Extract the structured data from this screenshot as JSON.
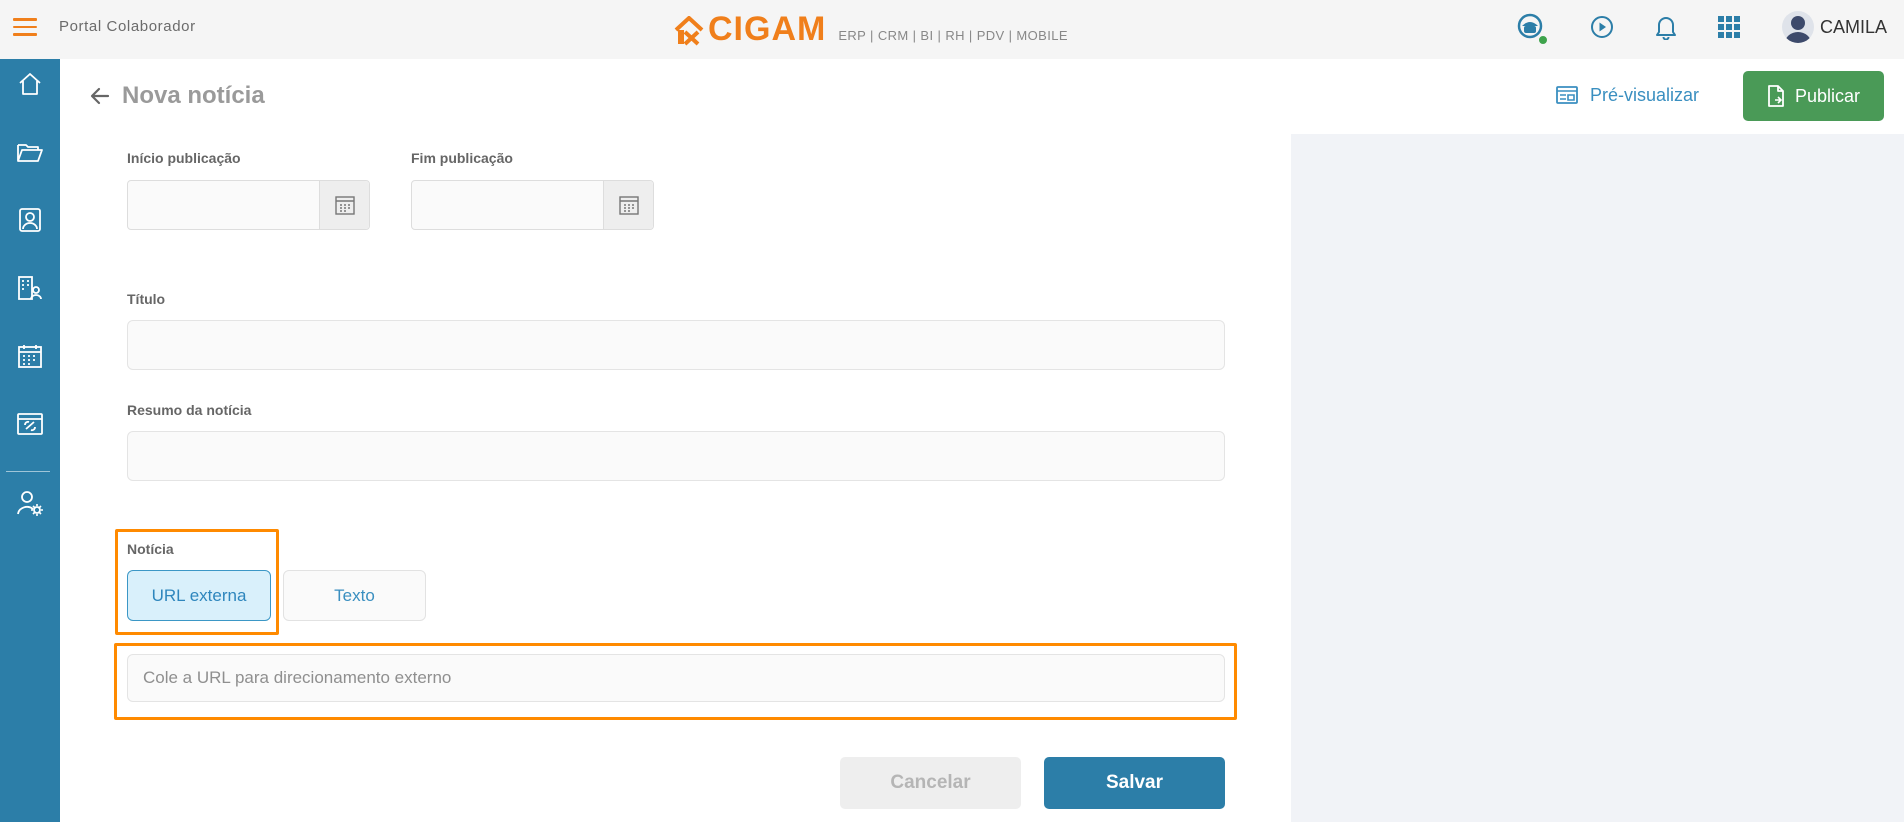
{
  "topbar": {
    "portal_title": "Portal Colaborador",
    "brand_name": "CIGAM",
    "brand_subtitle": "ERP | CRM | BI | RH | PDV | MOBILE",
    "user_name": "CAMILA",
    "status_color": "#3ea34c",
    "accent_color": "#f07f1b"
  },
  "sidebar": {
    "color": "#2c7ea8",
    "items": [
      {
        "icon": "home-icon"
      },
      {
        "icon": "folder-icon"
      },
      {
        "icon": "contact-card-icon"
      },
      {
        "icon": "building-person-icon"
      },
      {
        "icon": "calendar-icon"
      },
      {
        "icon": "document-link-icon"
      },
      {
        "icon": "user-settings-icon"
      }
    ]
  },
  "header": {
    "title": "Nova notícia",
    "preview_label": "Pré-visualizar",
    "publish_label": "Publicar"
  },
  "form": {
    "start_label": "Início publicação",
    "end_label": "Fim publicação",
    "title_label": "Título",
    "summary_label": "Resumo da notícia",
    "news_label": "Notícia",
    "option_url": "URL externa",
    "option_text": "Texto",
    "selected_option": "URL externa",
    "url_placeholder": "Cole a URL para direcionamento externo",
    "cancel_label": "Cancelar",
    "save_label": "Salvar"
  }
}
